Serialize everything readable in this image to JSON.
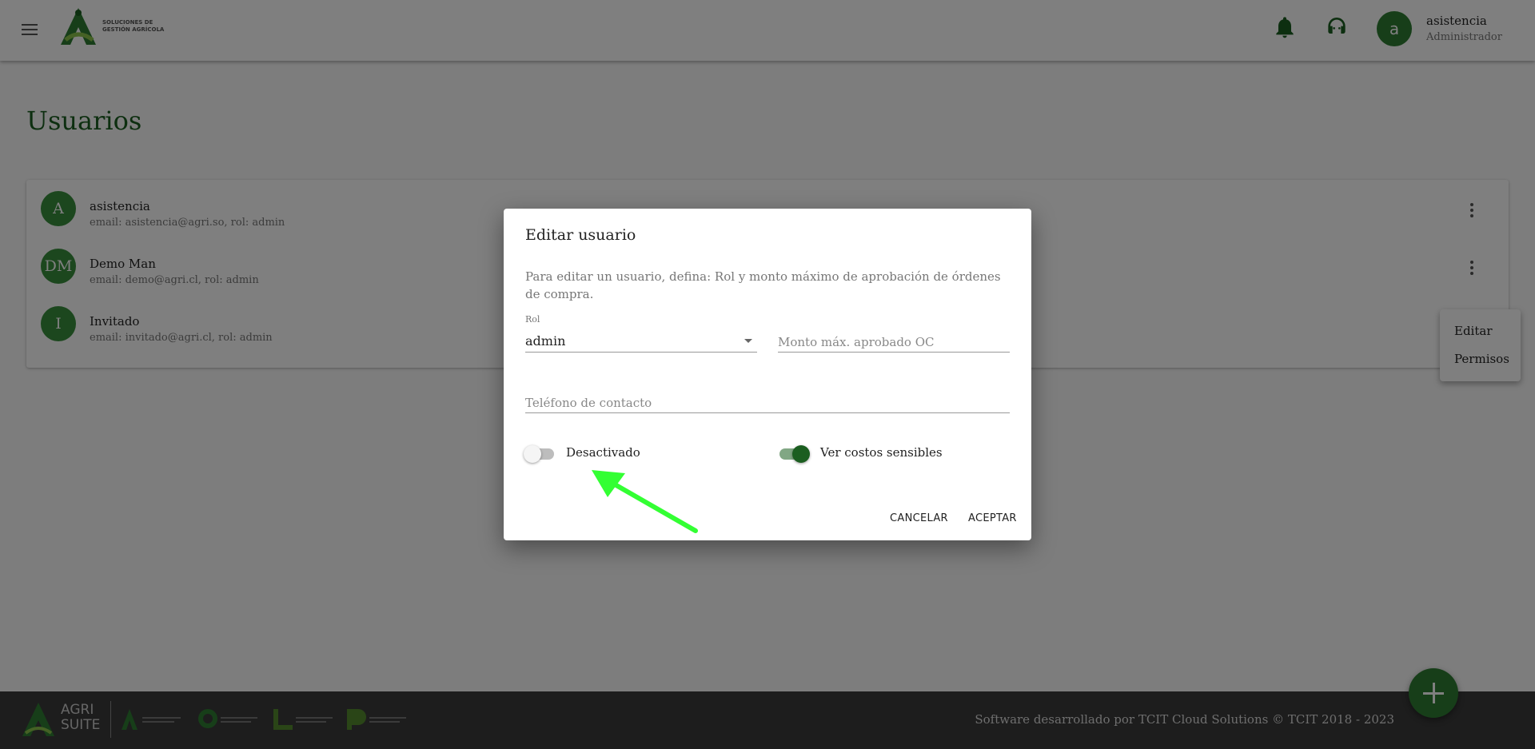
{
  "header": {
    "logo_text": "SOLUCIONES DE GESTIÓN AGRÍCOLA",
    "logo_brand": "AGRI",
    "user_initial": "a",
    "user_name": "asistencia",
    "user_role": "Administrador"
  },
  "page": {
    "title": "Usuarios"
  },
  "users": [
    {
      "initials": "A",
      "name": "asistencia",
      "detail": "email: asistencia@agri.so, rol: admin"
    },
    {
      "initials": "DM",
      "name": "Demo Man",
      "detail": "email: demo@agri.cl, rol: admin"
    },
    {
      "initials": "I",
      "name": "Invitado",
      "detail": "email: invitado@agri.cl, rol: admin"
    }
  ],
  "context_menu": {
    "edit": "Editar",
    "permissions": "Permisos"
  },
  "dialog": {
    "title": "Editar usuario",
    "description": "Para editar un usuario, defina: Rol y monto máximo de aprobación de órdenes de compra.",
    "role_label": "Rol",
    "role_value": "admin",
    "max_amount_placeholder": "Monto máx. aprobado OC",
    "phone_placeholder": "Teléfono de contacto",
    "active_switch_label": "Desactivado",
    "active_switch_on": false,
    "sensitive_costs_label": "Ver costos sensibles",
    "sensitive_costs_on": true,
    "cancel_label": "CANCELAR",
    "accept_label": "ACEPTAR"
  },
  "footer": {
    "brand": "AGRI SUITE",
    "credit": "Software desarrollado por TCIT Cloud Solutions © TCIT 2018 - 2023"
  },
  "colors": {
    "primary": "#2e7d32",
    "title_green": "#1b5e20",
    "footer_bg": "#3a3a3a",
    "annotation_arrow": "#33ff33"
  },
  "icons": {
    "menu": "menu-icon",
    "notifications": "bell-icon",
    "support": "headset-icon",
    "more": "more-vert-icon",
    "add": "plus-icon",
    "dropdown": "chevron-down-icon"
  }
}
